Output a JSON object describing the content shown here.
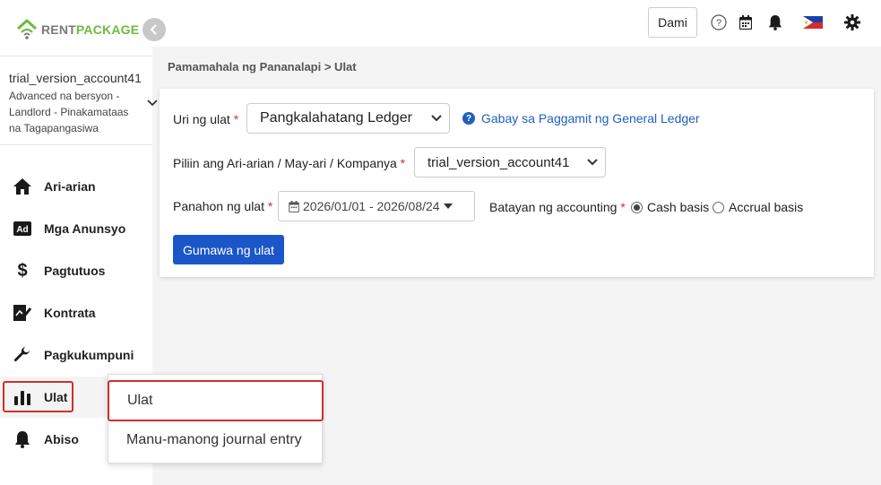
{
  "brand": {
    "rent": "RENT",
    "package": "PACKAGE"
  },
  "account": {
    "name": "trial_version_account41",
    "role": "Advanced na bersyon - Landlord - Pinakamataas na Tagapangasiwa"
  },
  "sidebar": {
    "items": [
      {
        "label": "Ari-arian",
        "icon": "home-icon"
      },
      {
        "label": "Mga Anunsyo",
        "icon": "ad-icon"
      },
      {
        "label": "Pagtutuos",
        "icon": "dollar-icon"
      },
      {
        "label": "Kontrata",
        "icon": "contract-icon"
      },
      {
        "label": "Pagkukumpuni",
        "icon": "wrench-icon"
      },
      {
        "label": "Ulat",
        "icon": "bar-chart-icon",
        "active": true
      },
      {
        "label": "Abiso",
        "icon": "bell-icon"
      }
    ]
  },
  "submenu": {
    "items": [
      {
        "label": "Ulat"
      },
      {
        "label": "Manu-manong journal entry"
      }
    ]
  },
  "header": {
    "more_label": "Dami",
    "icons": [
      "help-icon",
      "calendar-icon",
      "bell-icon",
      "philippines-flag-icon",
      "gear-icon"
    ]
  },
  "breadcrumb": "Pamamahala ng Pananalapi > Ulat",
  "form": {
    "report_type_label": "Uri ng ulat",
    "report_type_value": "Pangkalahatang Ledger",
    "guide_link": "Gabay sa Paggamit ng General Ledger",
    "entity_label": "Piliin ang Ari-arian / May-ari / Kompanya",
    "entity_value": "trial_version_account41",
    "period_label": "Panahon ng ulat",
    "period_value": "2026/01/01 - 2026/08/24",
    "basis_label": "Batayan ng accounting",
    "basis_options": [
      "Cash basis",
      "Accrual basis"
    ],
    "basis_selected": "Cash basis",
    "required_mark": "*",
    "generate_label": "Gumawa ng ulat"
  },
  "colors": {
    "brand_green": "#6dbb3c",
    "primary_button": "#1a56c8",
    "link": "#1f5fbf",
    "highlight_outline": "#d42d2d"
  }
}
